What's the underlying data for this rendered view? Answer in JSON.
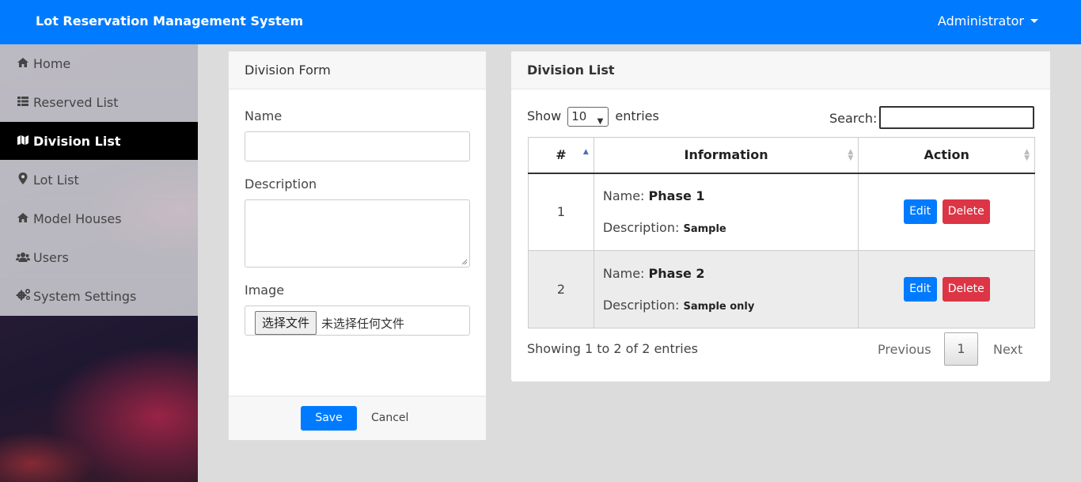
{
  "app": {
    "title": "Lot Reservation Management System",
    "user_menu": "Administrator"
  },
  "sidebar": {
    "items": [
      {
        "label": "Home",
        "icon": "home-icon"
      },
      {
        "label": "Reserved List",
        "icon": "list-icon"
      },
      {
        "label": "Division List",
        "icon": "map-icon",
        "active": true
      },
      {
        "label": "Lot List",
        "icon": "map-marker-icon"
      },
      {
        "label": "Model Houses",
        "icon": "home-icon"
      },
      {
        "label": "Users",
        "icon": "users-icon"
      },
      {
        "label": "System Settings",
        "icon": "cogs-icon"
      }
    ]
  },
  "form": {
    "title": "Division Form",
    "name_label": "Name",
    "name_value": "",
    "description_label": "Description",
    "description_value": "",
    "image_label": "Image",
    "file_button": "选择文件",
    "file_status": "未选择任何文件",
    "save_label": "Save",
    "cancel_label": "Cancel"
  },
  "list": {
    "title": "Division List",
    "show_label": "Show",
    "entries_value": "10",
    "entries_label": "entries",
    "search_label": "Search:",
    "search_value": "",
    "columns": [
      "#",
      "Information",
      "Action"
    ],
    "rows": [
      {
        "num": "1",
        "name_prefix": "Name:",
        "name": "Phase 1",
        "desc_prefix": "Description:",
        "desc": "Sample",
        "edit": "Edit",
        "delete": "Delete"
      },
      {
        "num": "2",
        "name_prefix": "Name:",
        "name": "Phase 2",
        "desc_prefix": "Description:",
        "desc": "Sample only",
        "edit": "Edit",
        "delete": "Delete"
      }
    ],
    "showing": "Showing 1 to 2 of 2 entries",
    "prev_label": "Previous",
    "page": "1",
    "next_label": "Next"
  },
  "colors": {
    "primary": "#007bff",
    "danger": "#dc3545",
    "active_nav": "#000000"
  }
}
